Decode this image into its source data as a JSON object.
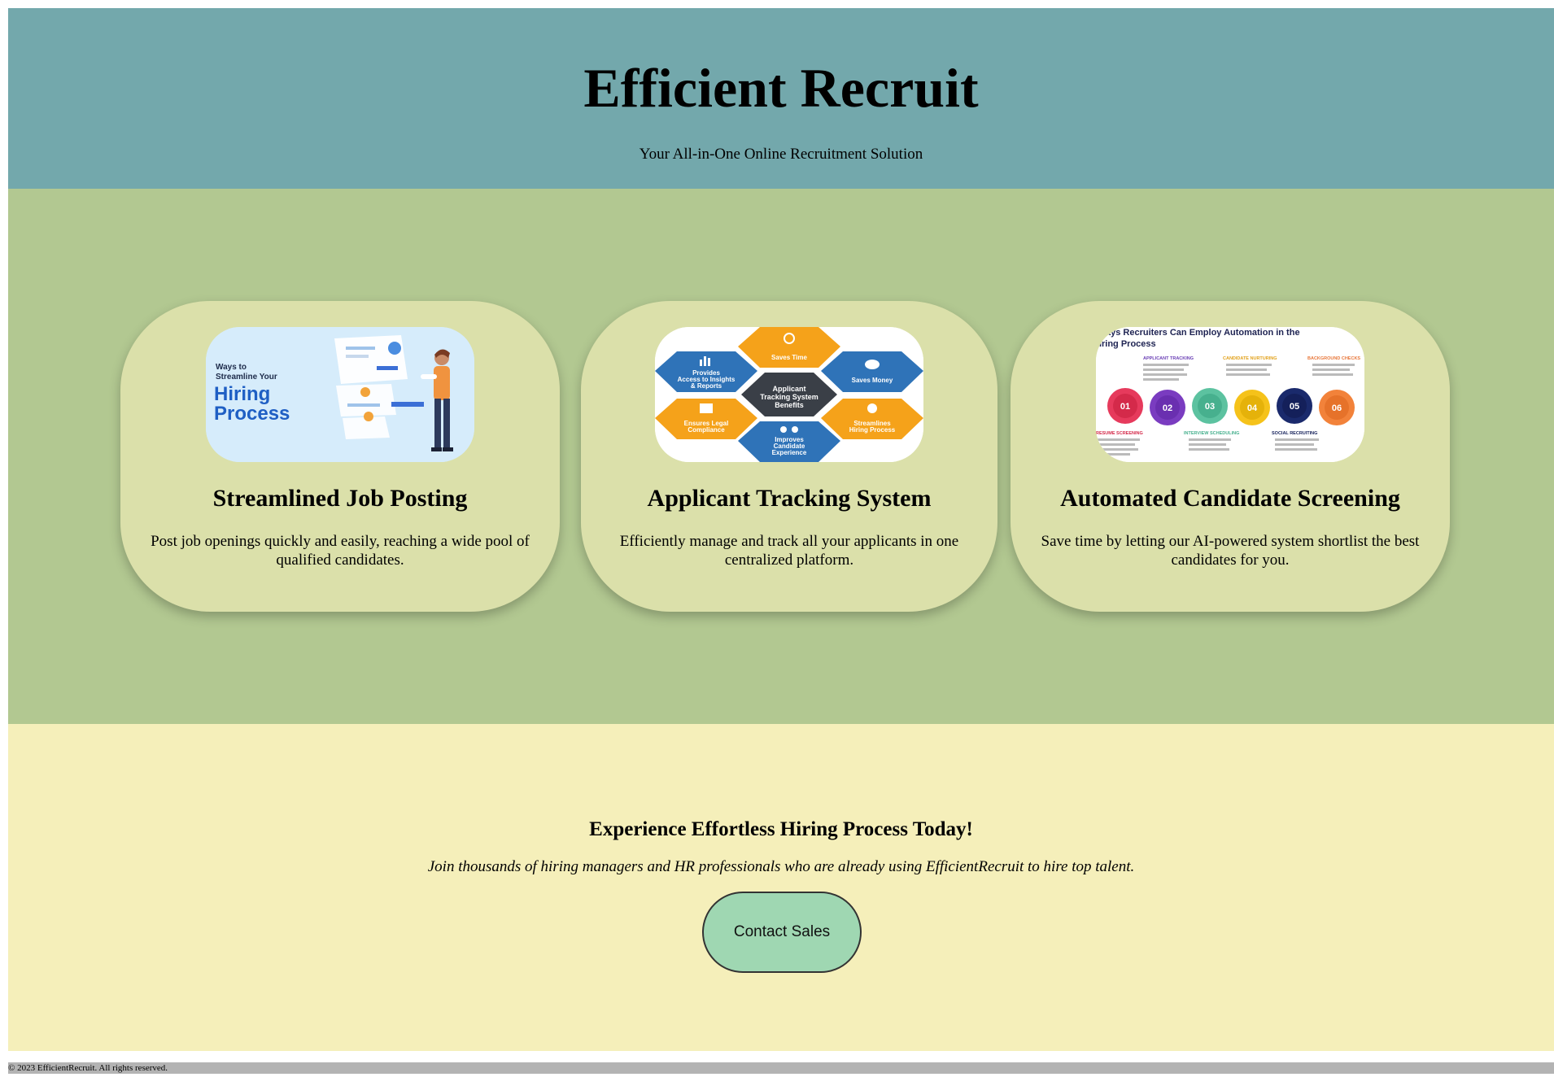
{
  "header": {
    "title": "Efficient Recruit",
    "subtitle": "Your All-in-One Online Recruitment Solution"
  },
  "features": [
    {
      "title": "Streamlined Job Posting",
      "description": "Post job openings quickly and easily, reaching a wide pool of qualified candidates.",
      "image": {
        "icon": "hiring-process-illustration",
        "line1": "Ways to",
        "line2": "Streamline Your",
        "line3": "Hiring",
        "line4": "Process"
      }
    },
    {
      "title": "Applicant Tracking System",
      "description": "Efficiently manage and track all your applicants in one centralized platform.",
      "image": {
        "icon": "ats-benefits-hexagon-diagram",
        "center": [
          "Applicant",
          "Tracking System",
          "Benefits"
        ],
        "hex_top": "Saves Time",
        "hex_top_left": [
          "Provides",
          "Access to Insights",
          "& Reports"
        ],
        "hex_top_right": "Saves Money",
        "hex_bottom_left": [
          "Ensures Legal",
          "Compliance"
        ],
        "hex_bottom_right": [
          "Streamlines",
          "Hiring Process"
        ],
        "hex_bottom": [
          "Improves",
          "Candidate",
          "Experience"
        ]
      }
    },
    {
      "title": "Automated Candidate Screening",
      "description": "Save time by letting our AI-powered system shortlist the best candidates for you.",
      "image": {
        "icon": "automation-steps-infographic",
        "heading1": "Ways Recruiters Can Employ Automation in the",
        "heading2": "Hiring Process",
        "labels": [
          "APPLICANT TRACKING",
          "CANDIDATE NURTURING",
          "BACKGROUND CHECKS",
          "RESUME SCREENING",
          "INTERVIEW SCHEDULING",
          "SOCIAL RECRUITING"
        ],
        "steps": [
          "01",
          "02",
          "03",
          "04",
          "05",
          "06"
        ]
      }
    }
  ],
  "cta": {
    "heading": "Experience Effortless Hiring Process Today!",
    "text": "Join thousands of hiring managers and HR professionals who are already using EfficientRecruit to hire top talent.",
    "button_label": "Contact Sales"
  },
  "footer": {
    "text": "© 2023 EfficientRecruit. All rights reserved."
  },
  "colors": {
    "header_bg": "#73a8ac",
    "features_bg": "#b2c891",
    "card_bg": "#dbe0aa",
    "cta_bg": "#f5efba",
    "button_bg": "#9fd7b2",
    "footer_bg": "#b3b3b3"
  }
}
